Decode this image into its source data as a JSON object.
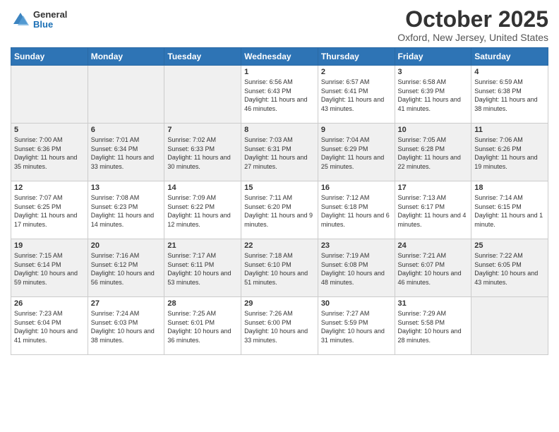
{
  "header": {
    "logo_general": "General",
    "logo_blue": "Blue",
    "month_title": "October 2025",
    "location": "Oxford, New Jersey, United States"
  },
  "days_of_week": [
    "Sunday",
    "Monday",
    "Tuesday",
    "Wednesday",
    "Thursday",
    "Friday",
    "Saturday"
  ],
  "weeks": [
    [
      {
        "day": "",
        "info": ""
      },
      {
        "day": "",
        "info": ""
      },
      {
        "day": "",
        "info": ""
      },
      {
        "day": "1",
        "info": "Sunrise: 6:56 AM\nSunset: 6:43 PM\nDaylight: 11 hours and 46 minutes."
      },
      {
        "day": "2",
        "info": "Sunrise: 6:57 AM\nSunset: 6:41 PM\nDaylight: 11 hours and 43 minutes."
      },
      {
        "day": "3",
        "info": "Sunrise: 6:58 AM\nSunset: 6:39 PM\nDaylight: 11 hours and 41 minutes."
      },
      {
        "day": "4",
        "info": "Sunrise: 6:59 AM\nSunset: 6:38 PM\nDaylight: 11 hours and 38 minutes."
      }
    ],
    [
      {
        "day": "5",
        "info": "Sunrise: 7:00 AM\nSunset: 6:36 PM\nDaylight: 11 hours and 35 minutes."
      },
      {
        "day": "6",
        "info": "Sunrise: 7:01 AM\nSunset: 6:34 PM\nDaylight: 11 hours and 33 minutes."
      },
      {
        "day": "7",
        "info": "Sunrise: 7:02 AM\nSunset: 6:33 PM\nDaylight: 11 hours and 30 minutes."
      },
      {
        "day": "8",
        "info": "Sunrise: 7:03 AM\nSunset: 6:31 PM\nDaylight: 11 hours and 27 minutes."
      },
      {
        "day": "9",
        "info": "Sunrise: 7:04 AM\nSunset: 6:29 PM\nDaylight: 11 hours and 25 minutes."
      },
      {
        "day": "10",
        "info": "Sunrise: 7:05 AM\nSunset: 6:28 PM\nDaylight: 11 hours and 22 minutes."
      },
      {
        "day": "11",
        "info": "Sunrise: 7:06 AM\nSunset: 6:26 PM\nDaylight: 11 hours and 19 minutes."
      }
    ],
    [
      {
        "day": "12",
        "info": "Sunrise: 7:07 AM\nSunset: 6:25 PM\nDaylight: 11 hours and 17 minutes."
      },
      {
        "day": "13",
        "info": "Sunrise: 7:08 AM\nSunset: 6:23 PM\nDaylight: 11 hours and 14 minutes."
      },
      {
        "day": "14",
        "info": "Sunrise: 7:09 AM\nSunset: 6:22 PM\nDaylight: 11 hours and 12 minutes."
      },
      {
        "day": "15",
        "info": "Sunrise: 7:11 AM\nSunset: 6:20 PM\nDaylight: 11 hours and 9 minutes."
      },
      {
        "day": "16",
        "info": "Sunrise: 7:12 AM\nSunset: 6:18 PM\nDaylight: 11 hours and 6 minutes."
      },
      {
        "day": "17",
        "info": "Sunrise: 7:13 AM\nSunset: 6:17 PM\nDaylight: 11 hours and 4 minutes."
      },
      {
        "day": "18",
        "info": "Sunrise: 7:14 AM\nSunset: 6:15 PM\nDaylight: 11 hours and 1 minute."
      }
    ],
    [
      {
        "day": "19",
        "info": "Sunrise: 7:15 AM\nSunset: 6:14 PM\nDaylight: 10 hours and 59 minutes."
      },
      {
        "day": "20",
        "info": "Sunrise: 7:16 AM\nSunset: 6:12 PM\nDaylight: 10 hours and 56 minutes."
      },
      {
        "day": "21",
        "info": "Sunrise: 7:17 AM\nSunset: 6:11 PM\nDaylight: 10 hours and 53 minutes."
      },
      {
        "day": "22",
        "info": "Sunrise: 7:18 AM\nSunset: 6:10 PM\nDaylight: 10 hours and 51 minutes."
      },
      {
        "day": "23",
        "info": "Sunrise: 7:19 AM\nSunset: 6:08 PM\nDaylight: 10 hours and 48 minutes."
      },
      {
        "day": "24",
        "info": "Sunrise: 7:21 AM\nSunset: 6:07 PM\nDaylight: 10 hours and 46 minutes."
      },
      {
        "day": "25",
        "info": "Sunrise: 7:22 AM\nSunset: 6:05 PM\nDaylight: 10 hours and 43 minutes."
      }
    ],
    [
      {
        "day": "26",
        "info": "Sunrise: 7:23 AM\nSunset: 6:04 PM\nDaylight: 10 hours and 41 minutes."
      },
      {
        "day": "27",
        "info": "Sunrise: 7:24 AM\nSunset: 6:03 PM\nDaylight: 10 hours and 38 minutes."
      },
      {
        "day": "28",
        "info": "Sunrise: 7:25 AM\nSunset: 6:01 PM\nDaylight: 10 hours and 36 minutes."
      },
      {
        "day": "29",
        "info": "Sunrise: 7:26 AM\nSunset: 6:00 PM\nDaylight: 10 hours and 33 minutes."
      },
      {
        "day": "30",
        "info": "Sunrise: 7:27 AM\nSunset: 5:59 PM\nDaylight: 10 hours and 31 minutes."
      },
      {
        "day": "31",
        "info": "Sunrise: 7:29 AM\nSunset: 5:58 PM\nDaylight: 10 hours and 28 minutes."
      },
      {
        "day": "",
        "info": ""
      }
    ]
  ]
}
